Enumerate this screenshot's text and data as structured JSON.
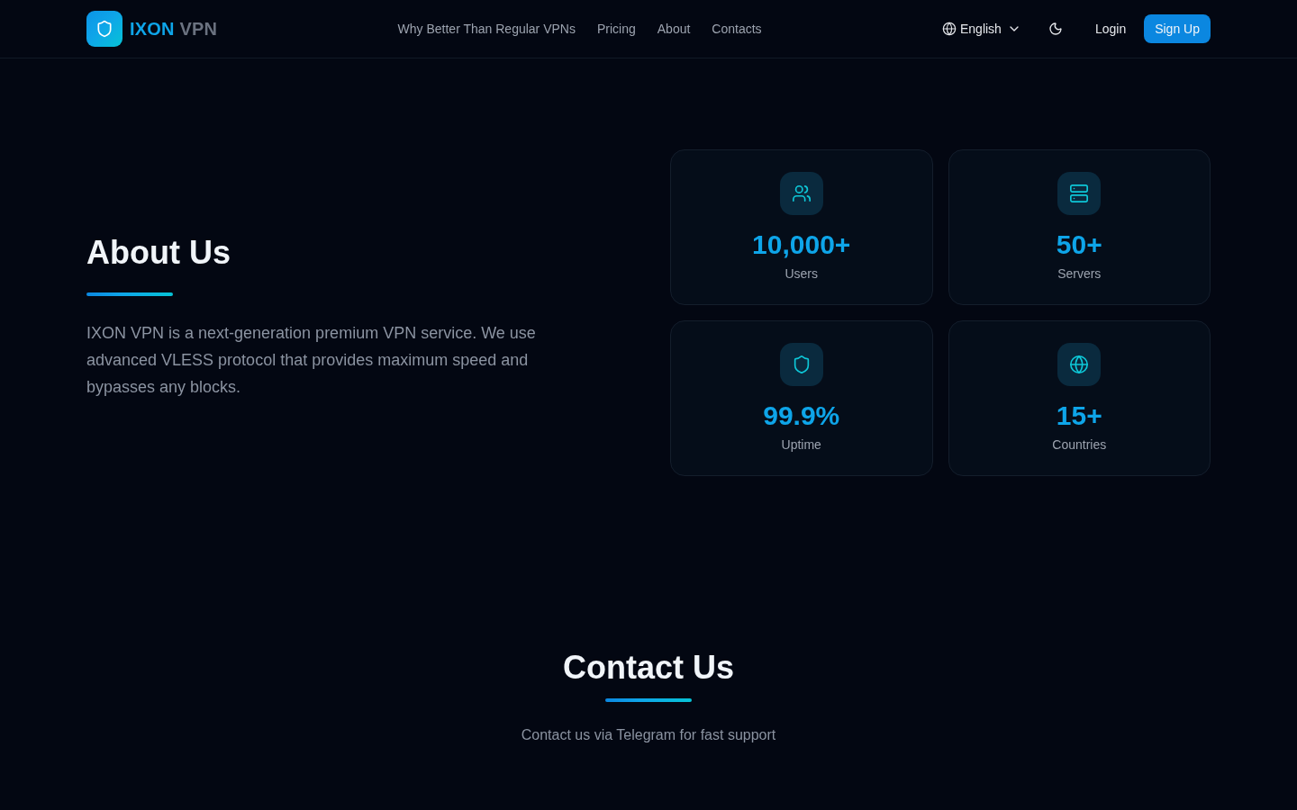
{
  "header": {
    "brand_primary": "IXON",
    "brand_secondary": "VPN",
    "nav_links": [
      "Why Better Than Regular VPNs",
      "Pricing",
      "About",
      "Contacts"
    ],
    "language": "English",
    "login": "Login",
    "signup": "Sign Up"
  },
  "about": {
    "title": "About Us",
    "description": "IXON VPN is a next-generation premium VPN service. We use advanced VLESS protocol that provides maximum speed and bypasses any blocks.",
    "stats": [
      {
        "kind": "users",
        "value": "10,000+",
        "label": "Users"
      },
      {
        "kind": "servers",
        "value": "50+",
        "label": "Servers"
      },
      {
        "kind": "uptime",
        "value": "99.9%",
        "label": "Uptime"
      },
      {
        "kind": "countries",
        "value": "15+",
        "label": "Countries"
      }
    ]
  },
  "contact": {
    "title": "Contact Us",
    "subtitle": "Contact us via Telegram for fast support"
  }
}
